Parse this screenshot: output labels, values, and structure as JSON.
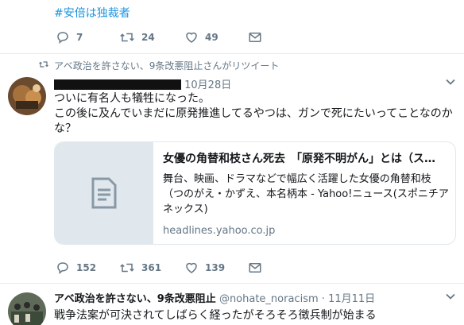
{
  "tweet1": {
    "hashtag": "#安倍は独裁者",
    "replies": "7",
    "retweets": "24",
    "likes": "49"
  },
  "tweet2": {
    "retweet_label": "アベ政治を許さない、9条改悪阻止さんがリツイート",
    "date": "10月28日",
    "text_line1": "ついに有名人も犠牲になった。",
    "text_line2": "この後に及んでいまだに原発推進してるやつは、ガンで死にたいってことなのかな？",
    "card": {
      "title": "女優の角替和枝さん死去　「原発不明がん」とは（ス…",
      "description": "舞台、映画、ドラマなどで幅広く活躍した女優の角替和枝（つのがえ・かずえ、本名柄本 - Yahoo!ニュース(スポニチアネックス)",
      "domain": "headlines.yahoo.co.jp"
    },
    "replies": "152",
    "retweets": "361",
    "likes": "139"
  },
  "tweet3": {
    "name": "アベ政治を許さない、9条改悪阻止",
    "handle": "@nohate_noracism",
    "date": "11月11日",
    "text": "戦争法案が可決されてしばらく経ったがそろそろ徴兵制が始まる"
  },
  "colors": {
    "link": "#1b95e0",
    "muted": "#657786",
    "divider": "#e6ecf0"
  }
}
